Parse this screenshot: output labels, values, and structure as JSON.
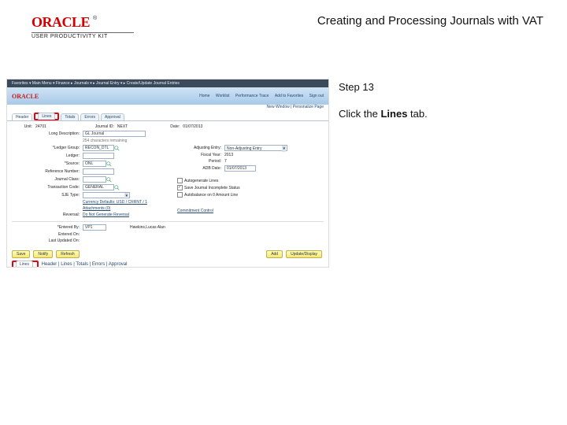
{
  "brand": {
    "logotype": "ORACLE",
    "tm": "®",
    "subline": "USER PRODUCTIVITY KIT"
  },
  "doc_title": "Creating and Processing Journals with VAT",
  "instruction": {
    "step": "Step 13",
    "pre": "Click the ",
    "bold": "Lines",
    "post": " tab."
  },
  "thumb": {
    "crumb": "Favorites ▾   Main Menu ▾   Finance   ▸  Journals ▾   ▸  Journal Entry ▾   ▸  Create/Update Journal Entries",
    "banner_logo": "ORACLE",
    "banner_links": [
      "Home",
      "Worklist",
      "Performance Trace",
      "Add to Favorites",
      "Sign out"
    ],
    "userline": "New Window | Personalize Page",
    "tabs": [
      "Header",
      "Lines",
      "Totals",
      "Errors",
      "Approval"
    ],
    "unit_lbl": "Unit:",
    "unit_val": "24701",
    "jid_lbl": "Journal ID:",
    "jid_val": "NEXT",
    "date_lbl": "Date:",
    "date_val": "01/07/2013",
    "longdesc_lbl": "Long Description:",
    "longdesc_val": "GL Journal",
    "chars": "254 characters remaining",
    "ledgergrp_lbl": "*Ledger Group:",
    "ledgergrp_val": "RECON_DTL",
    "adjent_lbl": "Adjusting Entry:",
    "adjent_val": "Non-Adjusting Entry",
    "ledger_lbl": "Ledger:",
    "fy_lbl": "Fiscal Year:",
    "fy_val": "2013",
    "source_lbl": "*Source:",
    "source_val": "ONL",
    "period_lbl": "Period:",
    "period_val": "7",
    "refno_lbl": "Reference Number:",
    "adbdate_lbl": "ADB Date:",
    "adbdate_val": "01/07/2013",
    "jclass_lbl": "Journal Class:",
    "autogen": "Autogenerate Lines",
    "trancode_lbl": "Transaction Code:",
    "trancode_val": "GENERAL",
    "savebkcp": "Save Journal Incomplete Status",
    "sjetype_lbl": "SJE Type:",
    "noautogen": "Autobalance on 0 Amount Line",
    "curr_link": "Currency Defaults: USD / CRRNT / 1",
    "attach_link": "Attachments (0)",
    "reversal_lbl": "Reversal:",
    "reversal_val": "Do Not Generate Reversal",
    "cc_link": "Commitment Control",
    "entby_lbl": "*Entered By:",
    "entby_val": "VP1",
    "entby_name": "Hawkins,Lucas Alan",
    "enton_lbl": "Entered On:",
    "lastupd_lbl": "Last Updated On:",
    "btns_left": [
      "Save",
      "Notify",
      "Refresh"
    ],
    "btns_right": [
      "Add",
      "Update/Display"
    ],
    "bottom_tab": "Lines",
    "footer_links": "Header | Lines | Totals | Errors | Approval"
  }
}
